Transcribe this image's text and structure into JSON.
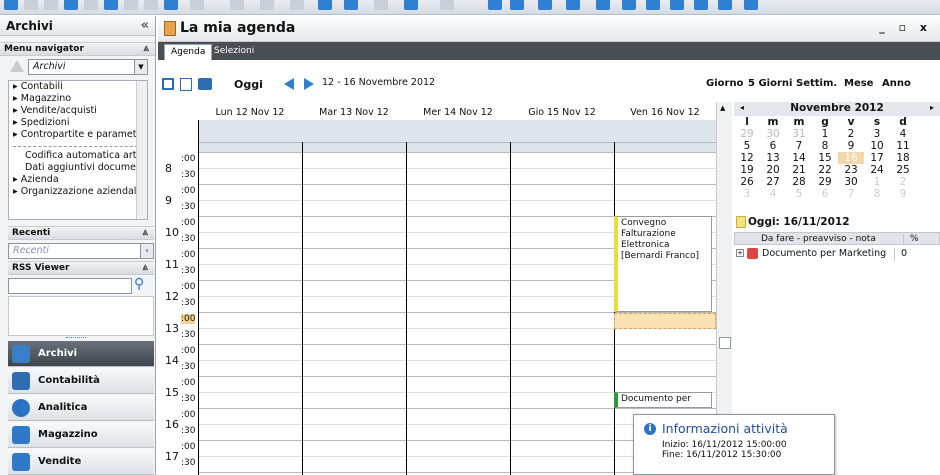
{
  "sidebar": {
    "title": "Archivi",
    "collapse_icon": "«",
    "menu_navigator": {
      "label": "Menu navigator",
      "combo_value": "Archivi",
      "items": [
        "Contabili",
        "Magazzino",
        "Vendite/acquisti",
        "Spedizioni",
        "Contropartite e parametri"
      ],
      "items2": [
        "Codifica automatica articoli",
        "Dati aggiuntivi documento"
      ],
      "items3": [
        "Azienda",
        "Organizzazione aziendale"
      ]
    },
    "recenti": {
      "label": "Recenti",
      "combo_placeholder": "Recenti"
    },
    "rss": {
      "label": "RSS Viewer"
    },
    "nav_buttons": [
      {
        "label": "Archivi",
        "icon": "archive-icon",
        "color": "#3a7dc9"
      },
      {
        "label": "Contabilità",
        "icon": "calculator-icon",
        "color": "#2f6db3"
      },
      {
        "label": "Analitica",
        "icon": "pie-chart-icon",
        "color": "#2b72c4"
      },
      {
        "label": "Magazzino",
        "icon": "forklift-icon",
        "color": "#2f79c8"
      },
      {
        "label": "Vendite",
        "icon": "sales-arrow-icon",
        "color": "#2f79c8"
      }
    ]
  },
  "window": {
    "title": "La mia agenda",
    "controls": "_ ▫ x"
  },
  "tabs": [
    {
      "label": "Agenda"
    },
    {
      "label": "Selezioni"
    }
  ],
  "agenda_toolbar": {
    "today_label": "Oggi",
    "range": "12 - 16 Novembre 2012",
    "views": [
      "Giorno",
      "5 Giorni",
      "Settim.",
      "Mese",
      "Anno"
    ]
  },
  "days": [
    "Lun 12 Nov 12",
    "Mar 13 Nov 12",
    "Mer 14 Nov 12",
    "Gio 15 Nov 12",
    "Ven 16 Nov 12"
  ],
  "hours": [
    "8",
    "9",
    "10",
    "11",
    "12",
    "13",
    "14",
    "15",
    "16",
    "17"
  ],
  "minutes": [
    ":00",
    ":30"
  ],
  "events": [
    {
      "text": "Convegno Falturazione Elettronica [Bernardi Franco]"
    },
    {
      "text": "Documento per"
    }
  ],
  "tooltip": {
    "title": "Informazioni attività",
    "start": "Inizio: 16/11/2012 15:00:00",
    "end": "Fine: 16/11/2012 15:30:00"
  },
  "mini_calendar": {
    "month": "Novembre 2012",
    "weekdays": [
      "l",
      "m",
      "m",
      "g",
      "v",
      "s",
      "d"
    ],
    "weeks": [
      [
        "29",
        "30",
        "31",
        "1",
        "2",
        "3",
        "4"
      ],
      [
        "5",
        "6",
        "7",
        "8",
        "9",
        "10",
        "11"
      ],
      [
        "12",
        "13",
        "14",
        "15",
        "16",
        "17",
        "18"
      ],
      [
        "19",
        "20",
        "21",
        "22",
        "23",
        "24",
        "25"
      ],
      [
        "26",
        "27",
        "28",
        "29",
        "30",
        "1",
        "2"
      ],
      [
        "3",
        "4",
        "5",
        "6",
        "7",
        "8",
        "9"
      ]
    ],
    "today_label": "Oggi: 16/11/2012"
  },
  "todo": {
    "header": "Da fare - preavviso - nota",
    "pct_header": "%",
    "rows": [
      {
        "label": "Documento per Marketing",
        "pct": "0"
      }
    ]
  }
}
